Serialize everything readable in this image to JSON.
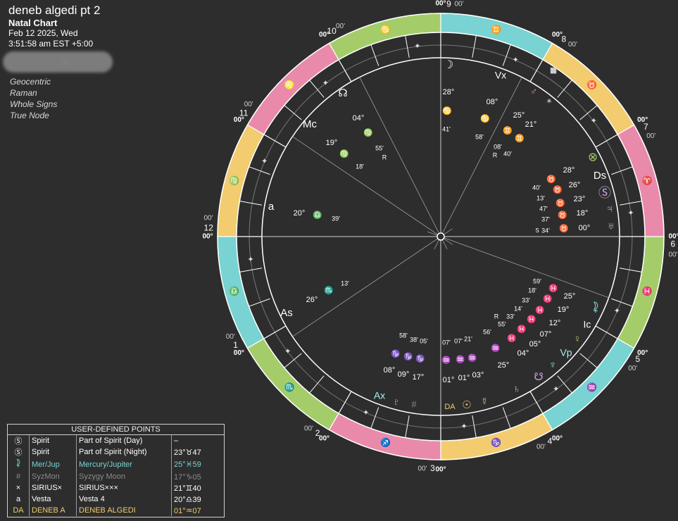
{
  "chart_info": {
    "title": "deneb algedi pt 2",
    "kind": "Natal Chart",
    "date": "Feb 12 2025, Wed",
    "time": "3:51:58 am  EST +5:00",
    "redacted_suffix": "..."
  },
  "settings": [
    "Geocentric",
    "Raman",
    "Whole Signs",
    "True Node"
  ],
  "colors": {
    "background": "#2d2d2d",
    "fire": "#e98aab",
    "earth": "#f2cc6e",
    "air": "#78d3d2",
    "water": "#a4cd6a",
    "ring_lines": "#cfcfcf",
    "yellow_text": "#f2cc6e"
  },
  "house_numbers": [
    "1",
    "2",
    "3",
    "4",
    "5",
    "6",
    "7",
    "8",
    "9",
    "10",
    "11",
    "12"
  ],
  "degree_marks": {
    "deg": "00°",
    "min": "00'"
  },
  "sign_glyphs": [
    "♋",
    "♌",
    "♍",
    "♎",
    "♏",
    "♐",
    "♑",
    "♒",
    "♓",
    "♈",
    "♉",
    "♊"
  ],
  "angles": {
    "asc": "As",
    "mc": "Mc",
    "dsc": "Ds",
    "ic": "Ic",
    "vertex": "Vx",
    "antivertex": "Ax",
    "vp": "Vp"
  },
  "planet_labels": [
    {
      "g": "☽",
      "deg": "28°",
      "sign": "♋",
      "min": "41'"
    },
    {
      "g": "♂",
      "deg": "25°",
      "sign": "♊",
      "min": "58'"
    },
    {
      "g": "✳",
      "deg": "21°",
      "sign": "♊",
      "min": "40'"
    },
    {
      "g": "☊",
      "deg": "04°",
      "sign": "♍",
      "min": "55'"
    },
    {
      "g": "⊗",
      "deg": "28°",
      "sign": "♉",
      "min": "40'"
    },
    {
      "g": "Ⓢ",
      "deg": "23°",
      "sign": "♉",
      "min": "47'"
    },
    {
      "g": "♃",
      "deg": "18°",
      "sign": "♉",
      "min": "37'"
    },
    {
      "g": "♅",
      "deg": "00°",
      "sign": "♉",
      "min": "34'"
    },
    {
      "g": "⯝",
      "deg": "25°",
      "sign": "♓",
      "min": "59'"
    },
    {
      "g": "♀",
      "deg": "07°",
      "sign": "♓",
      "min": "33'"
    },
    {
      "g": "♆",
      "deg": "25°",
      "sign": "♓",
      "min": "56'"
    },
    {
      "g": "☋",
      "deg": "04°",
      "sign": "♓",
      "min": "55'"
    },
    {
      "g": "♄",
      "deg": "17°",
      "sign": "♓",
      "min": "14'"
    },
    {
      "g": "☿",
      "deg": "03°",
      "sign": "♒",
      "min": "21'"
    },
    {
      "g": "☉",
      "deg": "01°",
      "sign": "♒",
      "min": "07'"
    },
    {
      "g": "♇",
      "deg": "01°",
      "sign": "♒",
      "min": "07'"
    },
    {
      "g": "a",
      "deg": "20°",
      "sign": "♎",
      "min": "39'"
    }
  ],
  "chart_texts": {
    "moon_deg": "28°",
    "moon_min": "41'",
    "vx_deg": "08°",
    "vx_min": "58'",
    "mars_deg": "25°",
    "mars_min": "08'",
    "sirius_deg": "21°",
    "sirius_min": "40'",
    "node_deg": "04°",
    "node_min": "55'",
    "mc_deg": "19°",
    "mc_min": "18'",
    "vesta_deg": "20°",
    "vesta_min": "39'",
    "asc_deg": "26°",
    "asc_min": "13'",
    "tau1": "28°",
    "tau2": "26°",
    "tau3": "23°",
    "tau4": "18°",
    "tau5": "00°",
    "tau_m1": "40'",
    "tau_m2": "13'",
    "tau_m3": "47'",
    "tau_m4": "37'",
    "tau_m5": "34'",
    "pis1": "25°",
    "pis2": "19°",
    "pis3": "12°",
    "pis4": "07°",
    "pis5": "05°",
    "pis6": "04°",
    "pis_m1": "59'",
    "pis_m2": "18'",
    "pis_m3": "33'",
    "pis_m4": "14'",
    "pis_m5": "33'",
    "pis_m6": "55'",
    "aqu1": "25°",
    "aqu2": "03°",
    "aqu3": "01°",
    "aqu4": "01°",
    "aqu_m1": "56'",
    "aqu_m2": "21'",
    "aqu_m3": "07'",
    "aqu_m4": "07'",
    "cap1": "17°",
    "cap2": "09°",
    "cap3": "08°",
    "cap_m1": "05'",
    "cap_m2": "38'",
    "cap_m3": "58'",
    "da": "DA",
    "rx": "R"
  },
  "user_defined_points": {
    "header": "USER-DEFINED POINTS",
    "header_dash": "–",
    "rows": [
      {
        "glyph": "Ⓢ",
        "name": "Spirit",
        "full": "Part of Spirit (Day)",
        "pos": "–",
        "color": "#ffffff"
      },
      {
        "glyph": "Ⓢ",
        "name": "Spirit",
        "full": "Part of Spirit (Night)",
        "pos": "23°♉47",
        "color": "#ffffff"
      },
      {
        "glyph": "⯝",
        "name": "Mer/Jup",
        "full": "Mercury/Jupiter",
        "pos": "25°♓59",
        "color": "#78d3d2"
      },
      {
        "glyph": "#",
        "name": "SyzMon",
        "full": "Syzygy Moon",
        "pos": "17°♑05",
        "color": "#8a8a8a"
      },
      {
        "glyph": "×",
        "name": "SIRIUS×",
        "full": "SIRIUS×××",
        "pos": "21°♊40",
        "color": "#ffffff"
      },
      {
        "glyph": "a",
        "name": "Vesta",
        "full": "Vesta 4",
        "pos": "20°♎39",
        "color": "#ffffff"
      },
      {
        "glyph": "DA",
        "name": "DENEB A",
        "full": "DENEB ALGEDI",
        "pos": "01°♒07",
        "color": "#f2cc6e"
      }
    ]
  }
}
